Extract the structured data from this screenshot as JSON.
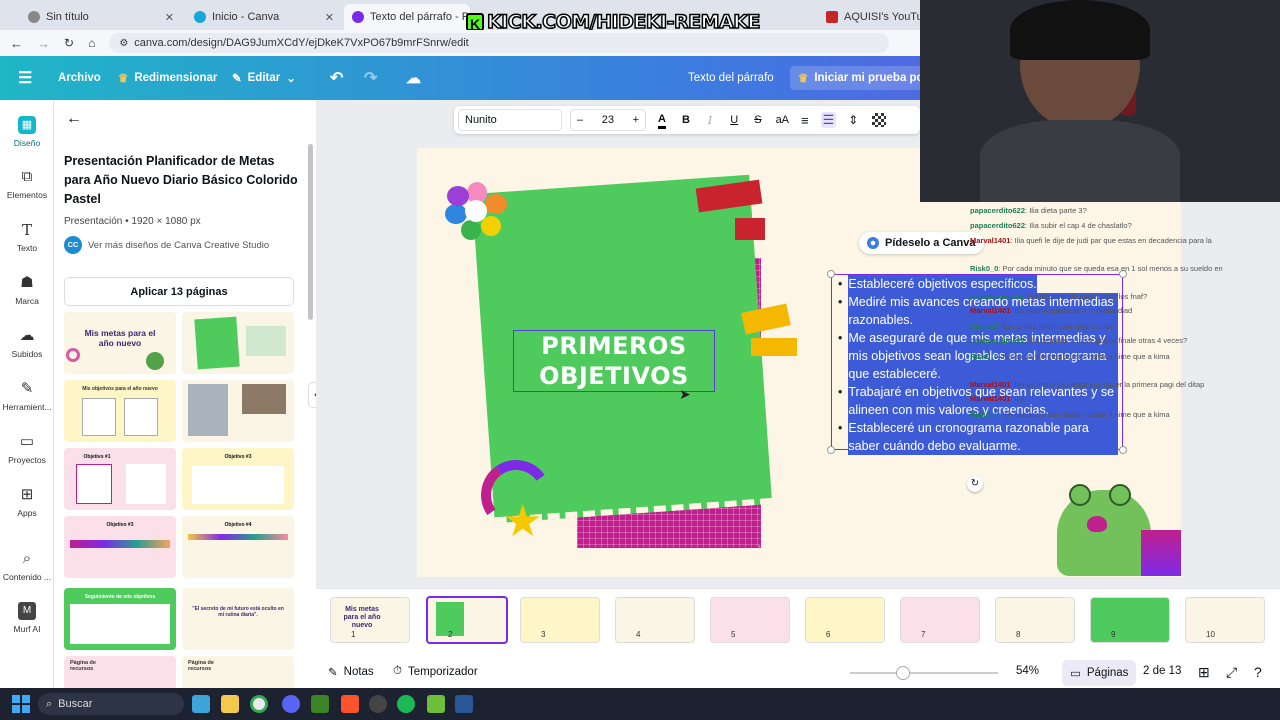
{
  "browser": {
    "tabs": [
      {
        "label": "Sin título"
      },
      {
        "label": "Inicio - Canva"
      },
      {
        "label": "Texto del párrafo - Presentación"
      },
      {
        "label": "AQUISI's YouTube Statis"
      }
    ],
    "url": "canva.com/design/DAG9JumXCdY/ejDkeK7VxPO67b9mrFSnrw/edit"
  },
  "overlay_watermark": "KICK.COM/HIDEKI-REMAKE",
  "header": {
    "menu_icon": "hamburger-icon",
    "archivo": "Archivo",
    "redimensionar": "Redimensionar",
    "editar": "Editar",
    "doc_title": "Texto del párrafo",
    "trial_button": "Iniciar mi prueba por"
  },
  "rail": {
    "items": [
      {
        "label": "Diseño",
        "icon": "design-icon"
      },
      {
        "label": "Elementos",
        "icon": "elements-icon"
      },
      {
        "label": "Texto",
        "icon": "text-icon"
      },
      {
        "label": "Marca",
        "icon": "brand-icon"
      },
      {
        "label": "Subidos",
        "icon": "upload-icon"
      },
      {
        "label": "Herramient...",
        "icon": "draw-icon"
      },
      {
        "label": "Proyectos",
        "icon": "folder-icon"
      },
      {
        "label": "Apps",
        "icon": "apps-icon"
      },
      {
        "label": "Contenido ...",
        "icon": "content-icon"
      },
      {
        "label": "Murf AI",
        "icon": "murf-icon"
      }
    ]
  },
  "panel": {
    "title": "Presentación Planificador de Metas para Año Nuevo Diario Básico Colorido Pastel",
    "meta": "Presentación • 1920 × 1080 px",
    "creator_initials": "CC",
    "creator_link": "Ver más diseños de Canva Creative Studio",
    "apply_button": "Aplicar 13 páginas",
    "thumb_titles": [
      "Mis metas para el año nuevo",
      "",
      "Mis objetivos para el año nuevo",
      "",
      "Objetivo #1",
      "Objetivo #3",
      "Objetivo #3",
      "Objetivo #4",
      "Seguimiento de mis objetivos",
      "\"El secreto de mi futuro está oculto en mi rutina diaria\".",
      "Página de recursos",
      "Página de recursos"
    ]
  },
  "toolbar": {
    "font": "Nunito",
    "minus": "–",
    "size": "23",
    "plus": "+",
    "bold": "B",
    "italic": "I",
    "underline": "U",
    "strike": "S",
    "case": "aA"
  },
  "slide": {
    "heading_line1": "PRIMEROS",
    "heading_line2": "OBJETIVOS",
    "ask_canva": "Pídeselo a Canva",
    "bullets": [
      "Estableceré objetivos específicos.",
      "Mediré mis avances creando metas intermedias razonables.",
      "Me aseguraré de que mis metas intermedias y mis objetivos sean logrables en el cronograma que estableceré.",
      "Trabajaré en objetivos que sean relevantes y se alineen con mis valores y creencias.",
      "Estableceré un cronograma razonable para saber cuándo debo evaluarme."
    ]
  },
  "pages": {
    "numbers": [
      "1",
      "2",
      "3",
      "4",
      "5",
      "6",
      "7",
      "8",
      "9",
      "10"
    ],
    "thumb1_title": "Mis metas para el año nuevo"
  },
  "bottom": {
    "notes": "Notas",
    "timer": "Temporizador",
    "zoom": "54%",
    "zoom_fraction": 0.54,
    "pages_label": "Páginas",
    "page_count": "2 de 13"
  },
  "taskbar": {
    "search_placeholder": "Buscar"
  },
  "chat": [
    {
      "user": "papacerdito622",
      "msg": ": Ilia dieta parte 3?"
    },
    {
      "user": "papacerdito622",
      "msg": ": Ilia subir el cap 4 de chaslatlo?"
    },
    {
      "user": "Marval1401",
      "msg": ": Ilia quefi le dije de judi par que estas en decadencia para la"
    },
    {
      "user": "Risk0_0",
      "msg": ": Por cada minuto que se queda esa en 1 sol menos a su sueldo en"
    },
    {
      "user": "joyconporcoso",
      "msg": ": Ilia terminar de jugar todos los fnaf?"
    },
    {
      "user": "Marval1401",
      "msg": ": Ilia podria quedarse a la profundiad"
    },
    {
      "user": "Stuner5",
      "msg": ": Ilia no has hecho que elija el chat"
    },
    {
      "user": "papacerdito622",
      "msg": ": Ilia terminar o jugar god of finale otras 4 veces?"
    },
    {
      "user": "Risk0_0",
      "msg": ": Ilia hablando mas barato visitar a nime que a kima"
    },
    {
      "user": "Marval1401",
      "msg": ": Ilia ya mano ya venga vay hacer la primera pagi del ditap"
    },
    {
      "user": "Marval1401",
      "msg": ": Ilia"
    },
    {
      "user": "Risk0_0",
      "msg": ": Ilia hablando mas barato visitar a nime que a kima"
    }
  ],
  "colors": {
    "header_start": "#1fb6c6",
    "header_end": "#6b4ee6",
    "slide_bg": "#fdf6e6",
    "green_paper": "#4fcb5e",
    "magenta": "#c0208d",
    "selection": "#3d5bd6",
    "accent_purple": "#7d2ae8"
  }
}
